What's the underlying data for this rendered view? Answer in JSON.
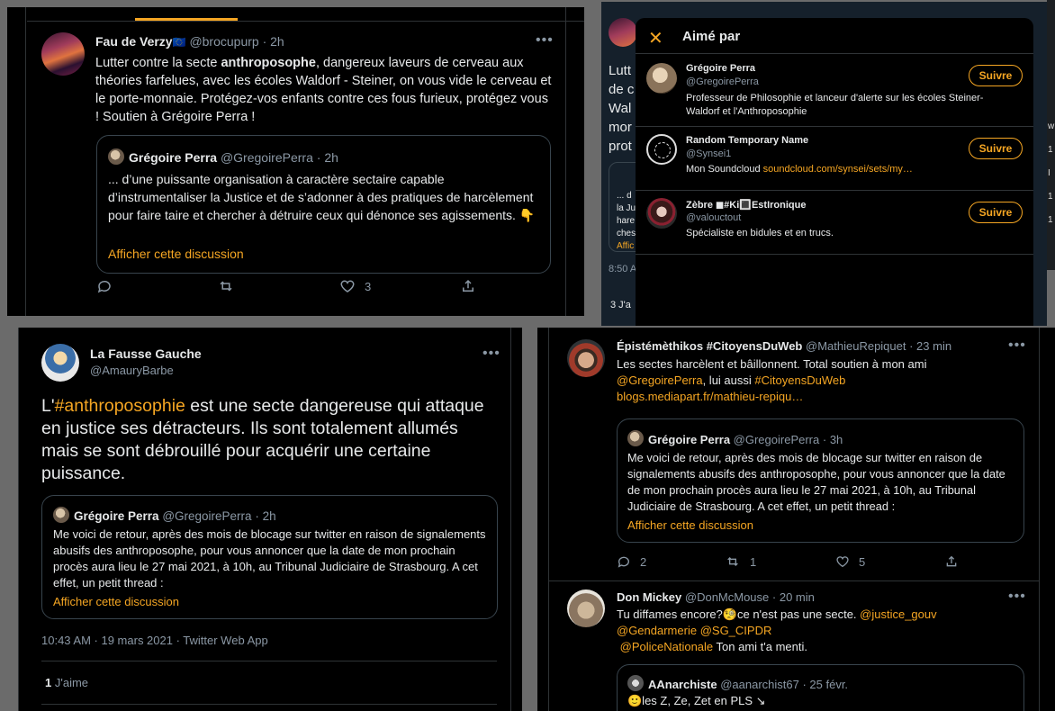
{
  "w1": {
    "author": "Fau de Verzy",
    "flag": "🇪🇺",
    "handle": "@brocupurp",
    "time": "· 2h",
    "text_a": "Lutter contre la secte ",
    "text_b": "anthroposophe",
    "text_c": ", dangereux laveurs de cerveau aux théories farfelues, avec les écoles Waldorf - Steiner, on vous vide le cerveau et le porte-monnaie. Protégez-vos enfants contre ces fous furieux, protégez vous ! Soutien à Grégoire Perra !",
    "quote": {
      "author": "Grégoire Perra",
      "handle": "@GregoirePerra",
      "time": "· 2h",
      "text": "... d’une puissante organisation à caractère sectaire capable d’instrumentaliser la Justice et de s’adonner à des pratiques de harcèlement pour faire taire et chercher à détruire ceux qui dénonce ses agissements. 👇",
      "link": "Afficher cette discussion"
    },
    "likes": "3"
  },
  "w2": {
    "title": "Aimé par",
    "bg_fragments": [
      "Lutt",
      "de c",
      "Wal",
      "mor",
      "prot"
    ],
    "bg_quote_fragments": [
      "... d",
      "la Ju",
      "hare",
      "ches",
      "Affic"
    ],
    "bg_time": "8:50 A",
    "bg_likes": "3 J'a",
    "users": [
      {
        "name": "Grégoire Perra",
        "handle": "@GregoirePerra",
        "bio": "Professeur de Philosophie et lanceur d'alerte sur les écoles Steiner-Waldorf et l'Anthroposophie",
        "follow": "Suivre"
      },
      {
        "name": "Random Temporary Name",
        "handle": "@Synsei1",
        "bio_a": "Mon Soundcloud ",
        "bio_link": "soundcloud.com/synsei/sets/my…",
        "follow": "Suivre"
      },
      {
        "name": "Zèbre ◼#Ki🔳EstIronique",
        "handle": "@valouctout",
        "bio": "Spécialiste en bidules et en trucs.",
        "follow": "Suivre"
      }
    ]
  },
  "w3": {
    "author": "La Fausse Gauche",
    "handle": "@AmauryBarbe",
    "text_a": "L'",
    "hashtag": "#anthroposophie",
    "text_b": " est une secte dangereuse qui attaque en justice ses détracteurs. Ils sont totalement allumés mais se sont débrouillé pour acquérir une certaine puissance.",
    "quote": {
      "author": "Grégoire Perra",
      "handle": "@GregoirePerra",
      "time": "· 2h",
      "text": "Me voici de retour, après des mois de blocage sur twitter en raison de signalements abusifs des anthroposophe, pour vous annoncer que la date de mon prochain procès aura lieu le 27 mai 2021, à 10h, au Tribunal Judiciaire de Strasbourg.   A cet effet, un petit thread :",
      "link": "Afficher cette discussion"
    },
    "timestamp": "10:43 AM · 19 mars 2021 · Twitter Web App",
    "likes_count": "1",
    "likes_label": "J'aime"
  },
  "w4": {
    "t1": {
      "author": "Épistémèthikos #CitoyensDuWeb",
      "handle": "@MathieuRepiquet",
      "time": "· 23 min",
      "line1": "Les sectes harcèlent et bâillonnent. Total soutien à mon ami",
      "mention": "@GregoirePerra",
      "mid": ", lui aussi ",
      "hashtag": "#CitoyensDuWeb",
      "link": "blogs.mediapart.fr/mathieu-repiqu…",
      "quote": {
        "author": "Grégoire Perra",
        "handle": "@GregoirePerra",
        "time": "· 3h",
        "text": "Me voici de retour, après des mois de blocage sur twitter en raison de signalements abusifs des anthroposophe, pour vous annoncer que la date de mon prochain procès aura lieu le 27 mai 2021, à 10h, au Tribunal Judiciaire de Strasbourg.  A cet effet, un petit thread :",
        "link": "Afficher cette discussion"
      },
      "replies": "2",
      "retweets": "1",
      "likes": "5"
    },
    "t2": {
      "author": "Don Mickey",
      "handle": "@DonMcMouse",
      "time": "· 20 min",
      "text_a": "Tu diffames encore?🧐ce n'est pas une secte. ",
      "m1": "@justice_gouv",
      "m2": "@Gendarmerie",
      "m3": "@SG_CIPDR",
      "m4": "@PoliceNationale",
      "text_b": " Ton ami t'a menti.",
      "quote": {
        "author": "AAnarchiste",
        "handle": "@aanarchist67",
        "time": "· 25 févr.",
        "text": "🙂les Z, Ze, Zet en PLS ↘"
      }
    }
  },
  "right_strip": {
    "fragments": [
      "w",
      "1",
      "I",
      "1",
      "1"
    ]
  }
}
